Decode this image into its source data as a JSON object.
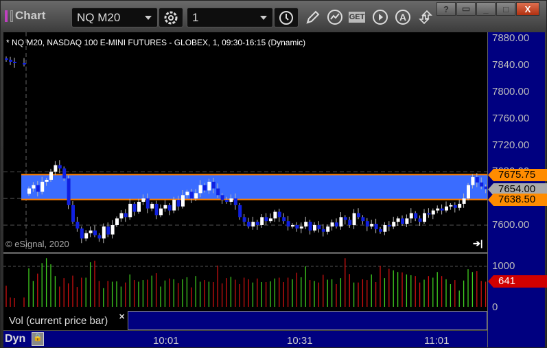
{
  "window": {
    "title": "Chart",
    "help": "?",
    "minimize": "_",
    "maximize": "□",
    "close": "X"
  },
  "toolbar": {
    "symbol": "NQ M20",
    "interval": "1",
    "icons": [
      "settings-icon",
      "clock-icon",
      "pencil-icon",
      "study-icon",
      "get-icon",
      "play-icon",
      "alert-icon",
      "swap-icon"
    ]
  },
  "chart": {
    "header": "* NQ M20, NASDAQ 100 E-MINI FUTURES - GLOBEX, 1, 09:30-16:15 (Dynamic)",
    "copyright": "© eSignal, 2020",
    "price_labels": [
      "7880.00",
      "7840.00",
      "7800.00",
      "7760.00",
      "7720.00",
      "7680.00",
      "7600.00"
    ],
    "price_ticks": [
      7880,
      7840,
      7800,
      7760,
      7720,
      7680,
      7600
    ],
    "grid_prices": [
      7680,
      7640,
      7600
    ],
    "band": {
      "high": 7675.75,
      "low": 7638.5,
      "color": "#3a6cff",
      "line_color": "#ff8000"
    },
    "badges": {
      "high": "7675.75",
      "last": "7654.00",
      "low": "7638.50"
    },
    "colors": {
      "up": "#ffffff",
      "down": "#1020e0",
      "vol_up": "#40d020",
      "vol_down": "#d01010",
      "axis_bg": "#000080"
    },
    "pre_closes": [
      7848,
      7845,
      7843,
      7842
    ],
    "closes": [
      7655,
      7660,
      7650,
      7665,
      7668,
      7680,
      7690,
      7685,
      7670,
      7630,
      7605,
      7595,
      7580,
      7588,
      7592,
      7585,
      7580,
      7598,
      7586,
      7600,
      7610,
      7618,
      7612,
      7632,
      7620,
      7635,
      7640,
      7625,
      7632,
      7615,
      7625,
      7630,
      7622,
      7638,
      7628,
      7645,
      7650,
      7640,
      7648,
      7660,
      7652,
      7665,
      7655,
      7645,
      7638,
      7635,
      7640,
      7630,
      7612,
      7605,
      7598,
      7605,
      7600,
      7612,
      7606,
      7610,
      7620,
      7612,
      7606,
      7598,
      7600,
      7595,
      7598,
      7605,
      7592,
      7600,
      7594,
      7590,
      7598,
      7604,
      7598,
      7612,
      7608,
      7600,
      7618,
      7612,
      7606,
      7598,
      7602,
      7594,
      7590,
      7600,
      7598,
      7605,
      7610,
      7602,
      7610,
      7618,
      7610,
      7605,
      7618,
      7616,
      7622,
      7625,
      7622,
      7628,
      7630,
      7626,
      7632,
      7640,
      7660,
      7672,
      7664,
      7658,
      7654
    ]
  },
  "volume": {
    "labels": [
      "1000",
      "0"
    ],
    "last": "641",
    "legend": "Vol (current price bar)",
    "values": [
      520,
      230,
      220,
      230,
      950,
      640,
      820,
      1080,
      1200,
      1050,
      760,
      500,
      710,
      580,
      770,
      490,
      720,
      720,
      1100,
      1140,
      640,
      460,
      640,
      620,
      630,
      500,
      600,
      800,
      660,
      620,
      660,
      670,
      770,
      830,
      500,
      650,
      700,
      680,
      590,
      680,
      730,
      480,
      760,
      620,
      660,
      620,
      610,
      1020,
      580,
      710,
      740,
      670,
      560,
      720,
      680,
      600,
      700,
      610,
      610,
      630,
      700,
      720,
      610,
      720,
      680,
      840,
      730,
      1000,
      660,
      640,
      600,
      790,
      670,
      680,
      560,
      710,
      1200,
      810,
      600,
      600,
      680,
      660,
      800,
      610,
      1010,
      710,
      940,
      900,
      860,
      850,
      800,
      780,
      760,
      600,
      670,
      760,
      720,
      860,
      760,
      680,
      560,
      660,
      400,
      650,
      930,
      860,
      880,
      640,
      620
    ]
  },
  "time_axis": {
    "labels": [
      "10:01",
      "10:31",
      "11:01"
    ],
    "mode": "Dyn"
  }
}
